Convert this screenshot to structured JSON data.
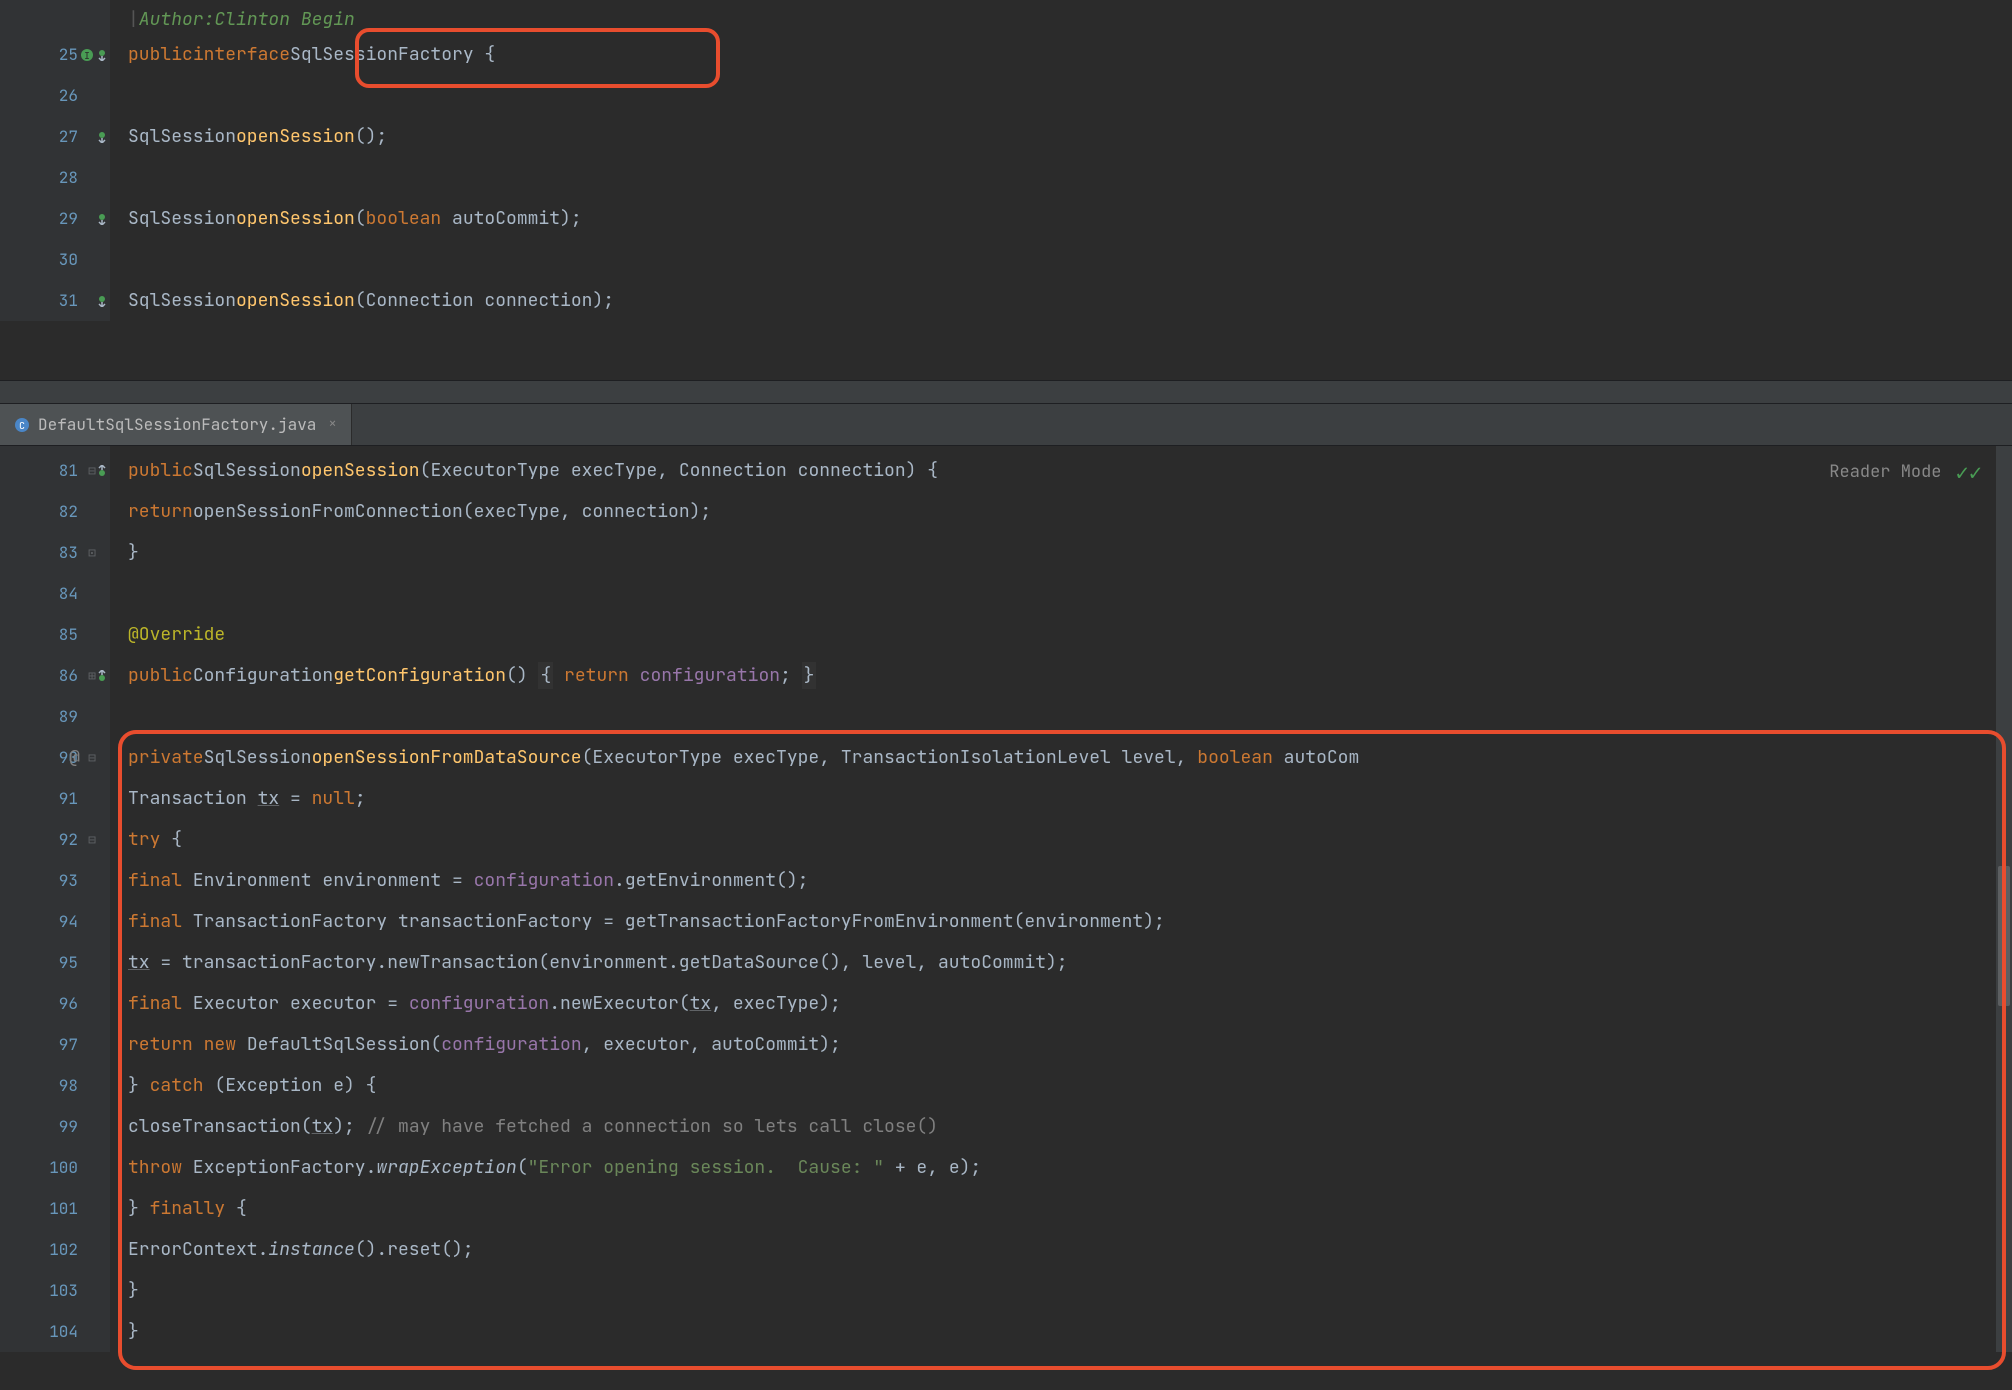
{
  "pane_top": {
    "doc_author_label": "Author:",
    "doc_author_value": "Clinton Begin",
    "lines": {
      "25": {
        "num": "25"
      },
      "26": {
        "num": "26"
      },
      "27": {
        "num": "27"
      },
      "28": {
        "num": "28"
      },
      "29": {
        "num": "29"
      },
      "30": {
        "num": "30"
      },
      "31": {
        "num": "31"
      }
    },
    "code": {
      "l25_public": "public",
      "l25_interface": "interface",
      "l25_name": "SqlSessionFactory",
      "l25_brace": " {",
      "l27_type": "SqlSession",
      "l27_method": "openSession",
      "l27_paren": "();",
      "l29_type": "SqlSession",
      "l29_method": "openSession",
      "l29_open": "(",
      "l29_ptype": "boolean",
      "l29_pname": " autoCommit",
      "l29_close": ");",
      "l31_type": "SqlSession",
      "l31_method": "openSession",
      "l31_open": "(",
      "l31_ptype": "Connection",
      "l31_pname": " connection",
      "l31_close": ");"
    }
  },
  "tab": {
    "filename": "DefaultSqlSessionFactory.java"
  },
  "reader_mode_label": "Reader Mode",
  "pane_bottom": {
    "lines": {
      "81": "81",
      "82": "82",
      "83": "83",
      "84": "84",
      "85": "85",
      "86": "86",
      "89": "89",
      "90": "90",
      "91": "91",
      "92": "92",
      "93": "93",
      "94": "94",
      "95": "95",
      "96": "96",
      "97": "97",
      "98": "98",
      "99": "99",
      "100": "100",
      "101": "101",
      "102": "102",
      "103": "103",
      "104": "104"
    },
    "code": {
      "l81": {
        "public": "public",
        "type": "SqlSession",
        "method": "openSession",
        "open": "(",
        "p1t": "ExecutorType",
        "p1n": " execType",
        "c1": ", ",
        "p2t": "Connection",
        "p2n": " connection",
        "close": ") {"
      },
      "l82": {
        "return": "return",
        "call": "openSessionFromConnection(execType",
        "c": ", ",
        "a2": "connection",
        "close": ");"
      },
      "l83": {
        "brace": "}"
      },
      "l85": {
        "annot": "@Override"
      },
      "l86": {
        "public": "public",
        "type": "Configuration",
        "method": "getConfiguration",
        "paren": "() ",
        "ob": "{",
        "ret": " return ",
        "field": "configuration",
        "semi": "; ",
        "cb": "}"
      },
      "l90": {
        "private": "private",
        "type": "SqlSession",
        "method": "openSessionFromDataSource",
        "open": "(",
        "p1t": "ExecutorType",
        "p1n": " execType",
        "c1": ", ",
        "p2t": "TransactionIsolationLevel",
        "p2n": " level",
        "c2": ", ",
        "p3t": "boolean",
        "p3n": " autoCom"
      },
      "l91": {
        "type": "Transaction ",
        "var": "tx",
        "eq": " = ",
        "null": "null",
        "semi": ";"
      },
      "l92": {
        "try": "try",
        "brace": " {"
      },
      "l93": {
        "final": "final",
        "type": " Environment environment = ",
        "field": "configuration",
        "call": ".getEnvironment();"
      },
      "l94": {
        "final": "final",
        "rest": " TransactionFactory transactionFactory = getTransactionFactoryFromEnvironment(environment);"
      },
      "l95": {
        "var": "tx",
        "rest": " = transactionFactory.newTransaction(environment.getDataSource(), level, autoCommit);"
      },
      "l96": {
        "final": "final",
        "type": " Executor executor = ",
        "field": "configuration",
        "rest": ".newExecutor(",
        "var": "tx",
        "rest2": ", execType);"
      },
      "l97": {
        "return": "return",
        "new": " new ",
        "ctor": "DefaultSqlSession(",
        "field": "configuration",
        "rest": ", executor, autoCommit);"
      },
      "l98": {
        "brace": "} ",
        "catch": "catch",
        "rest": " (Exception e) {"
      },
      "l99": {
        "call": "closeTransaction(",
        "var": "tx",
        "close": "); ",
        "comment": "// may have fetched a connection so lets call close()"
      },
      "l100": {
        "throw": "throw",
        "rest": " ExceptionFactory.",
        "ital": "wrapException",
        "open": "(",
        "str": "\"Error opening session.  Cause: \"",
        "rest2": " + e, e);"
      },
      "l101": {
        "brace": "} ",
        "finally": "finally",
        "ob": " {"
      },
      "l102": {
        "rest": "ErrorContext.",
        "ital": "instance",
        "rest2": "().reset();"
      },
      "l103": {
        "brace": "}"
      },
      "l104": {
        "brace": "}"
      }
    },
    "at_marker": "@"
  }
}
